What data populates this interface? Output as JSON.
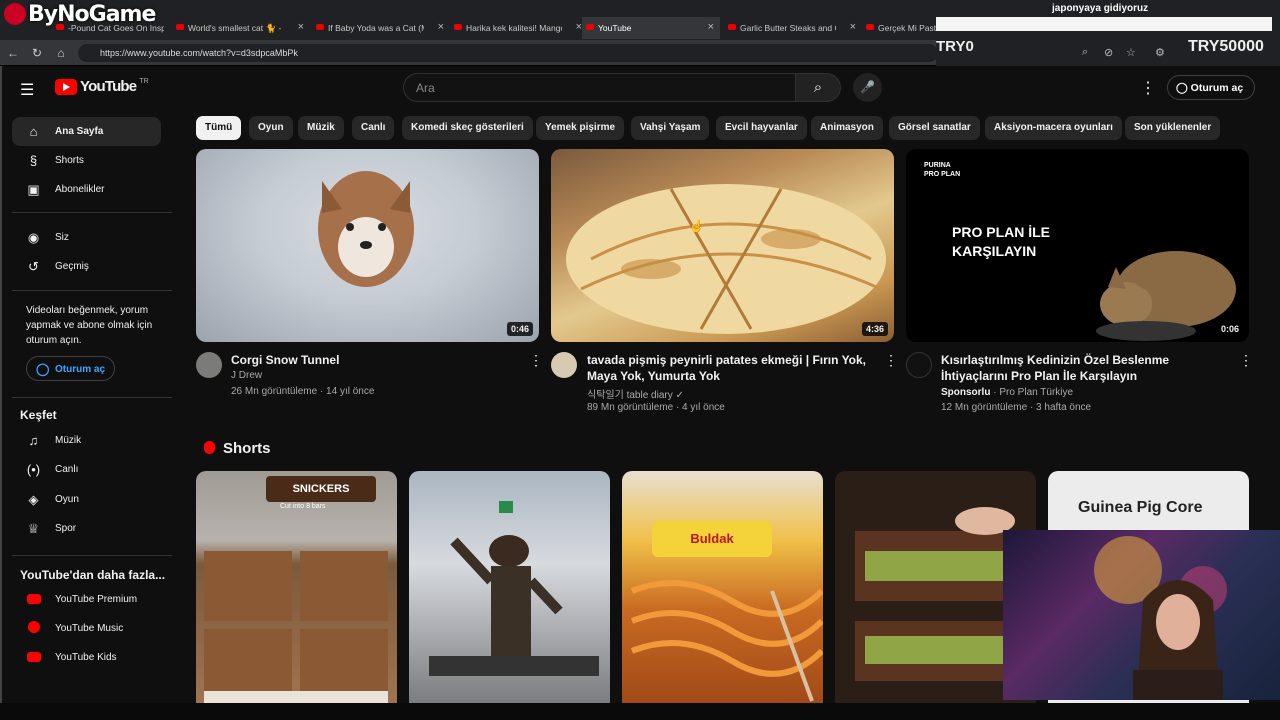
{
  "stream": {
    "logo": "ByNoGame",
    "title": "japonyaya gidiyoruz",
    "try0": "TRY0",
    "try50000": "TRY50000"
  },
  "browser": {
    "tabs": [
      {
        "label": "-Pound Cat Goes On Insp",
        "active": false
      },
      {
        "label": "World's smallest cat 🐈 - BB",
        "active": false
      },
      {
        "label": "If Baby Yoda was a Cat (Ma",
        "active": false
      },
      {
        "label": "Harika kek kalitesi! Mango",
        "active": false
      },
      {
        "label": "YouTube",
        "active": true
      },
      {
        "label": "Garlic Butter Steaks and Ca",
        "active": false
      },
      {
        "label": "Gerçek Mi Pasta",
        "active": false
      }
    ],
    "url": "https://www.youtube.com/watch?v=d3sdpcaMbPk"
  },
  "header": {
    "logo_word": "YouTube",
    "region": "TR",
    "search_placeholder": "Ara",
    "signin": "Oturum aç"
  },
  "sidebar": {
    "main": [
      {
        "label": "Ana Sayfa",
        "icon": "home-icon",
        "active": true
      },
      {
        "label": "Shorts",
        "icon": "shorts-icon"
      },
      {
        "label": "Abonelikler",
        "icon": "subscriptions-icon"
      }
    ],
    "you": [
      {
        "label": "Siz",
        "icon": "user-icon"
      },
      {
        "label": "Geçmiş",
        "icon": "history-icon"
      }
    ],
    "signin_message": "Videoları beğenmek, yorum yapmak ve abone olmak için oturum açın.",
    "signin_button": "Oturum aç",
    "explore_title": "Keşfet",
    "explore": [
      {
        "label": "Müzik",
        "icon": "music-icon"
      },
      {
        "label": "Canlı",
        "icon": "live-icon"
      },
      {
        "label": "Oyun",
        "icon": "gaming-icon"
      },
      {
        "label": "Spor",
        "icon": "trophy-icon"
      }
    ],
    "more_title": "YouTube'dan daha fazla...",
    "more": [
      {
        "label": "YouTube Premium"
      },
      {
        "label": "YouTube Music"
      },
      {
        "label": "YouTube Kids"
      }
    ]
  },
  "chips": [
    "Tümü",
    "Oyun",
    "Müzik",
    "Canlı",
    "Komedi skeç gösterileri",
    "Yemek pişirme",
    "Vahşi Yaşam",
    "Evcil hayvanlar",
    "Animasyon",
    "Görsel sanatlar",
    "Aksiyon-macera oyunları",
    "Son yüklenenler"
  ],
  "videos": [
    {
      "title": "Corgi Snow Tunnel",
      "channel": "J Drew",
      "meta": "26 Mn görüntüleme · 14 yıl önce",
      "duration": "0:46"
    },
    {
      "title": "tavada pişmiş peynirli patates ekmeği | Fırın Yok, Maya Yok, Yumurta Yok",
      "channel": "식탁일기 table diary",
      "meta": "89 Mn görüntüleme · 4 yıl önce",
      "duration": "4:36"
    },
    {
      "title": "Kısırlaştırılmış Kedinizin Özel Beslenme İhtiyaçlarını Pro Plan İle Karşılayın",
      "channel_prefix": "Sponsorlu",
      "channel": " · Pro Plan Türkiye",
      "meta": "12 Mn görüntüleme · 3 hafta önce",
      "duration": "0:06",
      "thumb_brand": "PURINA PRO PLAN",
      "thumb_text": "PRO PLAN İLE KARŞILAYIN"
    }
  ],
  "shorts": {
    "title": "Shorts",
    "items": [
      {
        "overlay": "Cut into 8 bars",
        "brand": "SNICKERS"
      },
      {
        "overlay": ""
      },
      {
        "overlay": "",
        "brand": "Buldak"
      },
      {
        "overlay": ""
      },
      {
        "overlay": "Guinea Pig Core"
      }
    ]
  }
}
